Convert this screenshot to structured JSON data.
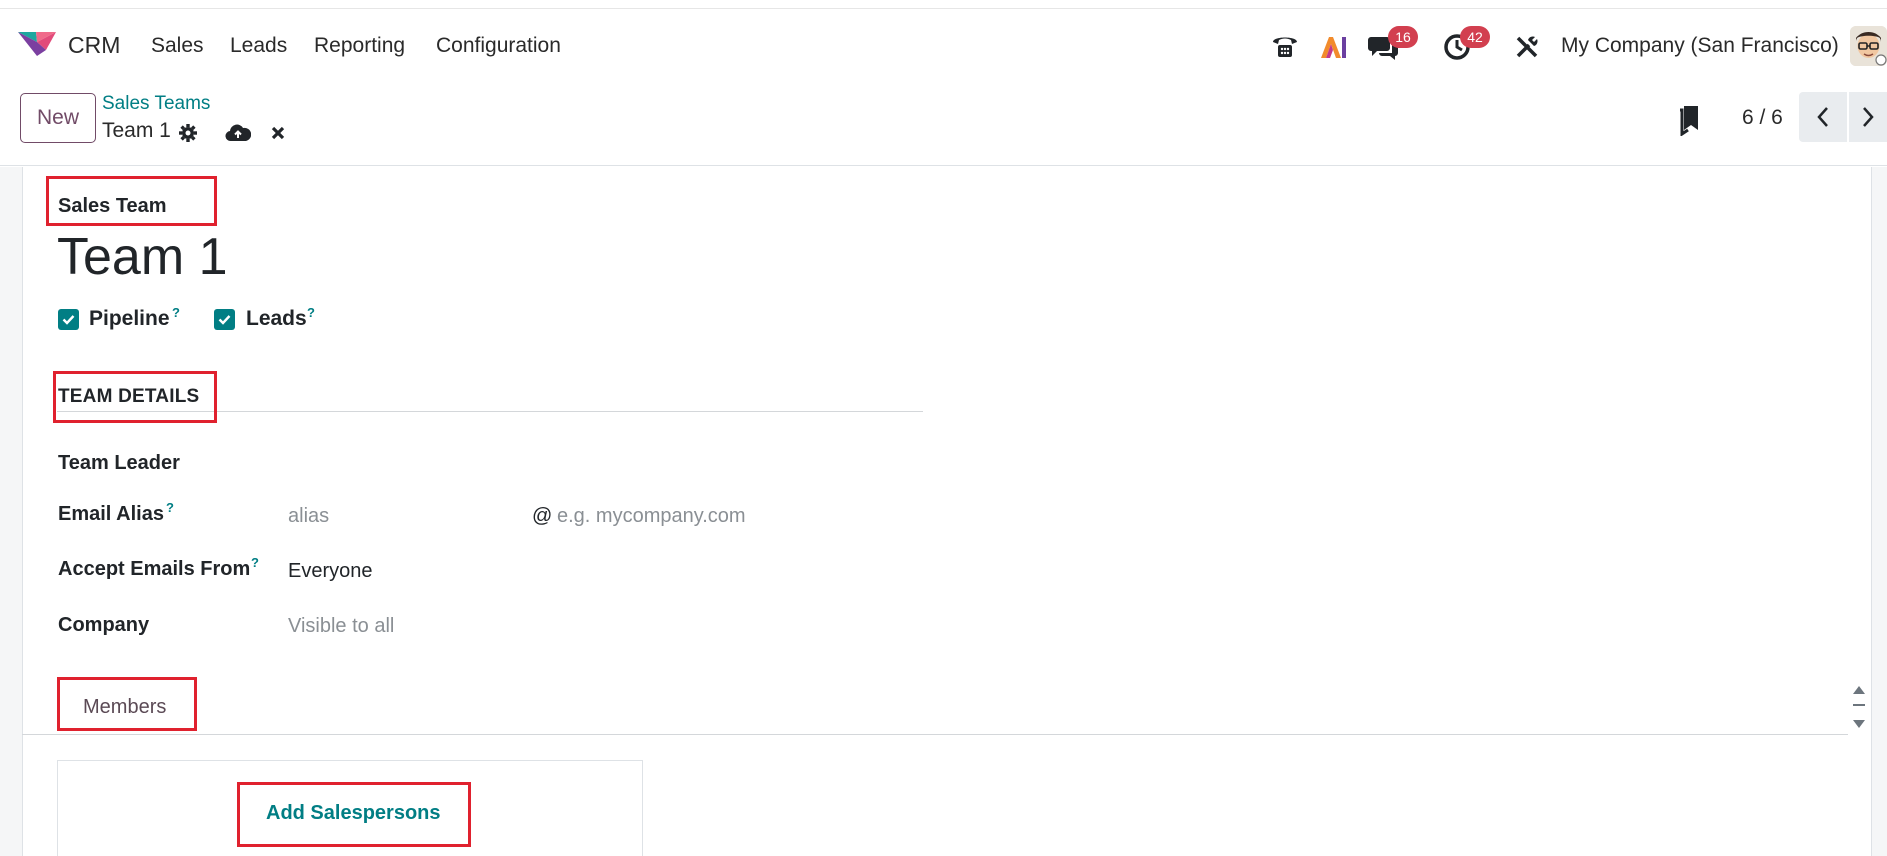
{
  "navbar": {
    "app_name": "CRM",
    "menu": [
      "Sales",
      "Leads",
      "Reporting",
      "Configuration"
    ],
    "icons": [
      "phone-icon",
      "ai-icon",
      "chat-icon",
      "activity-clock-icon",
      "debug-tools-icon"
    ],
    "messages_count": "16",
    "activities_count": "42",
    "company": "My Company (San Francisco)"
  },
  "control": {
    "new_label": "New",
    "breadcrumb": "Sales Teams",
    "record": "Team 1",
    "pager": "6 / 6"
  },
  "form": {
    "overline": "Sales Team",
    "title": "Team 1",
    "pipeline_label": "Pipeline",
    "leads_label": "Leads",
    "help_mark": "?",
    "section_title": "TEAM DETAILS",
    "team_leader_label": "Team Leader",
    "email_alias_label": "Email Alias",
    "alias_placeholder": "alias",
    "at_sign": "@",
    "domain_placeholder": "e.g. mycompany.com",
    "accept_from_label": "Accept Emails From",
    "accept_from_value": "Everyone",
    "company_label": "Company",
    "company_placeholder": "Visible to all"
  },
  "tabs": {
    "members": "Members"
  },
  "members": {
    "add_label": "Add Salespersons"
  },
  "colors": {
    "brand": "#714b67",
    "accent": "#017e84",
    "badge": "#d23f4f",
    "highlight": "#e0212e"
  }
}
